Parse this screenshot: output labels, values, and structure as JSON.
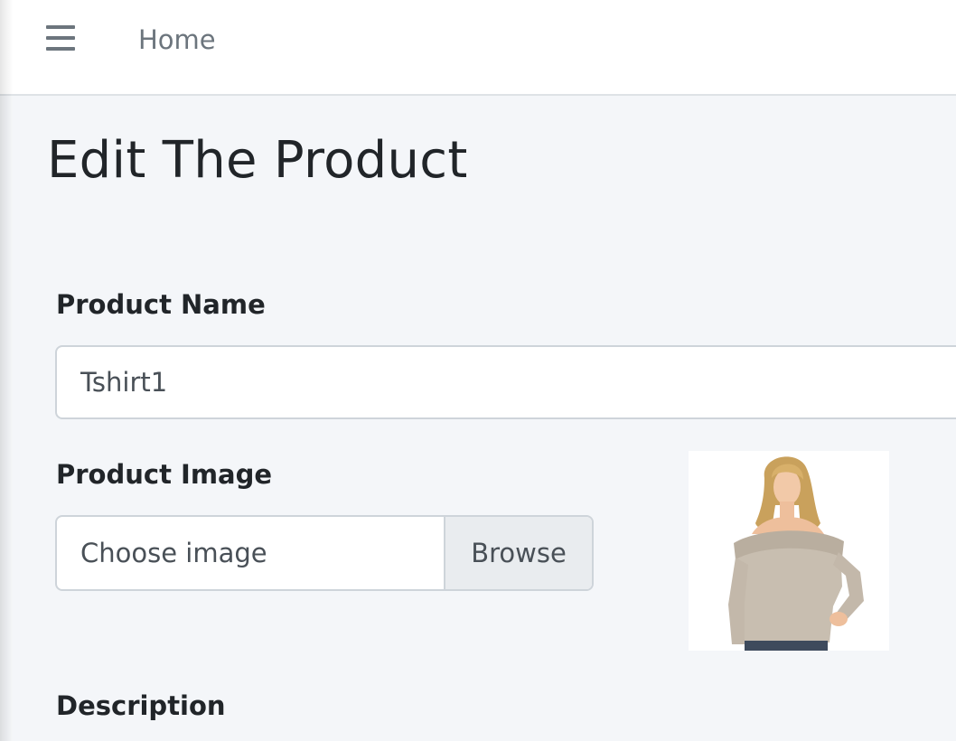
{
  "navbar": {
    "menu_icon": "hamburger-menu-icon",
    "home_label": "Home"
  },
  "page": {
    "title": "Edit The Product"
  },
  "form": {
    "product_name": {
      "label": "Product Name",
      "value": "Tshirt1"
    },
    "product_image": {
      "label": "Product Image",
      "placeholder": "Choose image",
      "browse_label": "Browse",
      "preview_icon": "product-image-preview"
    },
    "description": {
      "label": "Description"
    }
  },
  "colors": {
    "background": "#f4f6f9",
    "navbar": "#ffffff",
    "muted_text": "#6c757d",
    "border": "#ced4da",
    "button_bg": "#e9ecef"
  }
}
